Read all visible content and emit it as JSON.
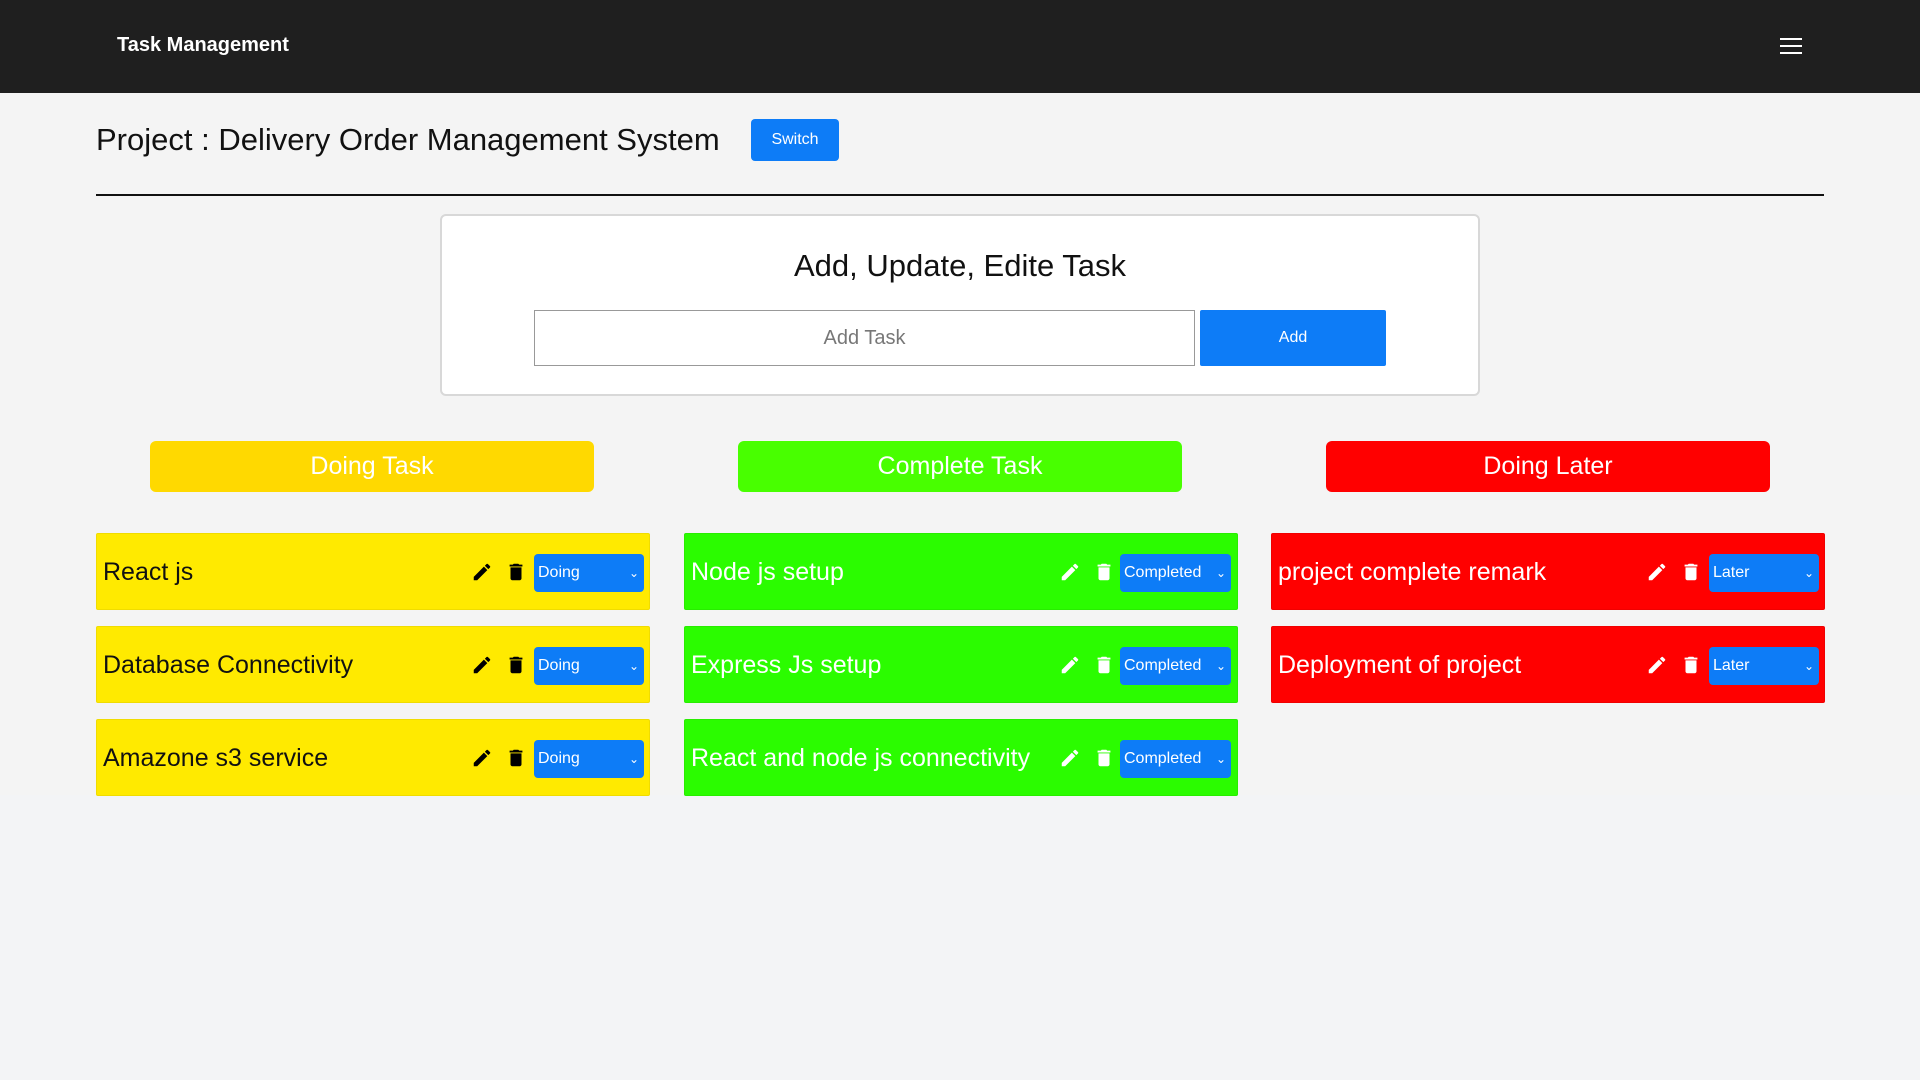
{
  "navbar": {
    "brand": "Task Management",
    "menu_icon": "hamburger-menu-icon"
  },
  "project": {
    "title": "Project : Delivery Order Management System",
    "switch_label": "Switch"
  },
  "add_card": {
    "heading": "Add, Update, Edite Task",
    "input_placeholder": "Add Task",
    "input_value": "",
    "add_label": "Add"
  },
  "columns": [
    {
      "header": "Doing Task",
      "header_color": "#ffd900",
      "card_color": "#ffea00",
      "text_color": "#111111",
      "icon_color": "#000000",
      "tasks": [
        {
          "name": "React js",
          "status": "Doing"
        },
        {
          "name": "Database Connectivity",
          "status": "Doing"
        },
        {
          "name": "Amazone s3 service",
          "status": "Doing"
        }
      ]
    },
    {
      "header": "Complete Task",
      "header_color": "#48ff00",
      "card_color": "#2bfc00",
      "text_color": "#ffffff",
      "icon_color": "#ffffff",
      "tasks": [
        {
          "name": "Node js setup",
          "status": "Completed"
        },
        {
          "name": "Express Js setup",
          "status": "Completed"
        },
        {
          "name": "React and node js connectivity",
          "status": "Completed"
        }
      ]
    },
    {
      "header": "Doing Later",
      "header_color": "#ff0000",
      "card_color": "#ff0000",
      "text_color": "#ffffff",
      "icon_color": "#ffffff",
      "tasks": [
        {
          "name": "project complete remark",
          "status": "Later"
        },
        {
          "name": "Deployment of project",
          "status": "Later"
        }
      ]
    }
  ],
  "colors": {
    "accent": "#0d7cf7",
    "navbar": "#1f1f1f"
  }
}
